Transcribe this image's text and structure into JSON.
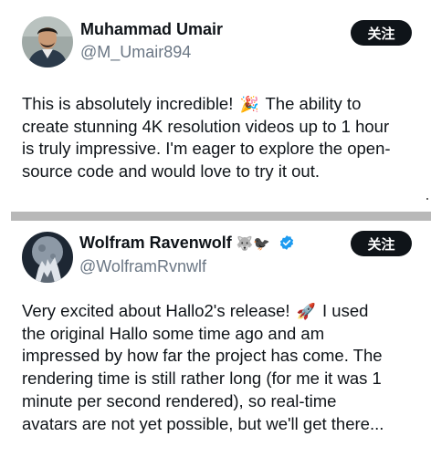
{
  "tweets": [
    {
      "name": "Muhammad Umair",
      "handle": "@M_Umair894",
      "follow_label": "关注",
      "avatar_icon": "profile-photo",
      "lines": [
        "This is absolutely incredible! ",
        " The ability to",
        "create stunning 4K resolution videos up to 1 hour",
        "is truly impressive. I'm eager to explore the open-",
        "source code and would love to try it out."
      ],
      "emoji": "🎉"
    },
    {
      "name": "Wolfram Ravenwolf",
      "name_emojis": "🐺🐦‍⬛",
      "verified": true,
      "handle": "@WolframRvnwlf",
      "follow_label": "关注",
      "avatar_icon": "wolf-moon-avatar",
      "lines": [
        "Very excited about Hallo2's release! ",
        " I used",
        "the original Hallo some time ago and am",
        "impressed by how far the project has come. The",
        "rendering time is still rather long (for me it was 1",
        "minute per second rendered), so real-time",
        "avatars are not yet possible, but we'll get there..."
      ],
      "emoji": "🚀"
    }
  ],
  "colors": {
    "text": "#0f1419",
    "handle": "#6b7785",
    "button_bg": "#0f1419",
    "verified": "#1d9bf0",
    "separator": "#b8b8b8"
  }
}
